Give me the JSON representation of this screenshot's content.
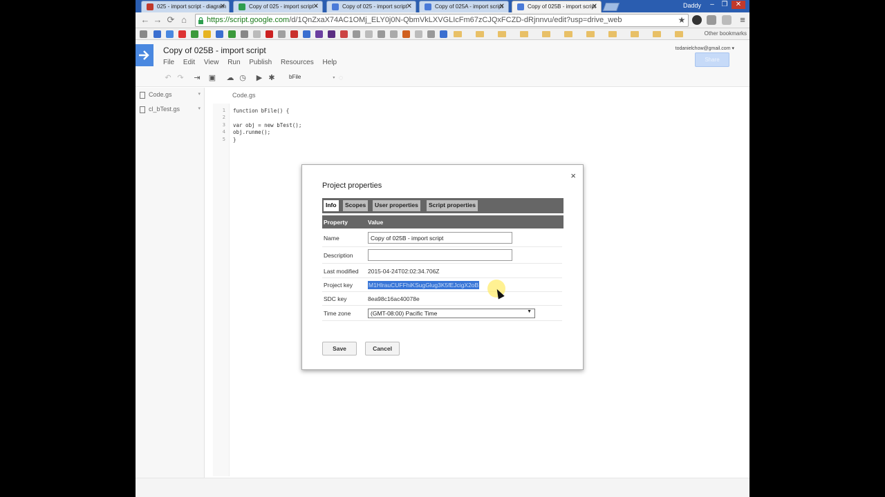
{
  "browser": {
    "tabs": [
      {
        "label": "025 - import script - diagram",
        "color": "#c0392b"
      },
      {
        "label": "Copy of 025 - import script -",
        "color": "#2e9e4f"
      },
      {
        "label": "Copy of 025 - import script",
        "color": "#4a7ad8"
      },
      {
        "label": "Copy of 025A - import script",
        "color": "#4a7ad8"
      },
      {
        "label": "Copy of 025B - import script",
        "color": "#4a7ad8"
      }
    ],
    "user": "Daddy",
    "url_host": "https://script.google.com",
    "url_path": "/d/1QnZxaX74AC1OMj_ELY0j0N-QbmVkLXVGLIcFm67zCJQxFCZD-dRjnnvu/edit?usp=drive_web",
    "other_bookmarks": "Other bookmarks"
  },
  "app": {
    "title": "Copy of 025B - import script",
    "menu": [
      "File",
      "Edit",
      "View",
      "Run",
      "Publish",
      "Resources",
      "Help"
    ],
    "account": "todanielchow@gmail.com",
    "share_label": "Share",
    "function_select": "bFile"
  },
  "files": [
    {
      "name": "Code.gs"
    },
    {
      "name": "cl_bTest.gs"
    }
  ],
  "editor": {
    "tab": "Code.gs",
    "line_numbers": [
      "1",
      "2",
      "3",
      "4",
      "5"
    ],
    "lines": [
      "function bFile() {",
      "",
      "var obj = new bTest();",
      "obj.runme();",
      "}"
    ]
  },
  "dialog": {
    "title": "Project properties",
    "close": "×",
    "tabs": [
      "Info",
      "Scopes",
      "User properties",
      "Script properties"
    ],
    "header": {
      "property": "Property",
      "value": "Value"
    },
    "rows": {
      "name": {
        "label": "Name",
        "value": "Copy of 025B - import script"
      },
      "description": {
        "label": "Description",
        "value": ""
      },
      "last_modified": {
        "label": "Last modified",
        "value": "2015-04-24T02:02:34.706Z"
      },
      "project_key": {
        "label": "Project key",
        "value": "M1HlrauCUFFhiKSugGlug3K5fEJcigX2oB"
      },
      "sdc_key": {
        "label": "SDC key",
        "value": "8ea98c16ac40078e"
      },
      "time_zone": {
        "label": "Time zone",
        "value": "(GMT-08:00) Pacific Time"
      }
    },
    "save": "Save",
    "cancel": "Cancel"
  }
}
